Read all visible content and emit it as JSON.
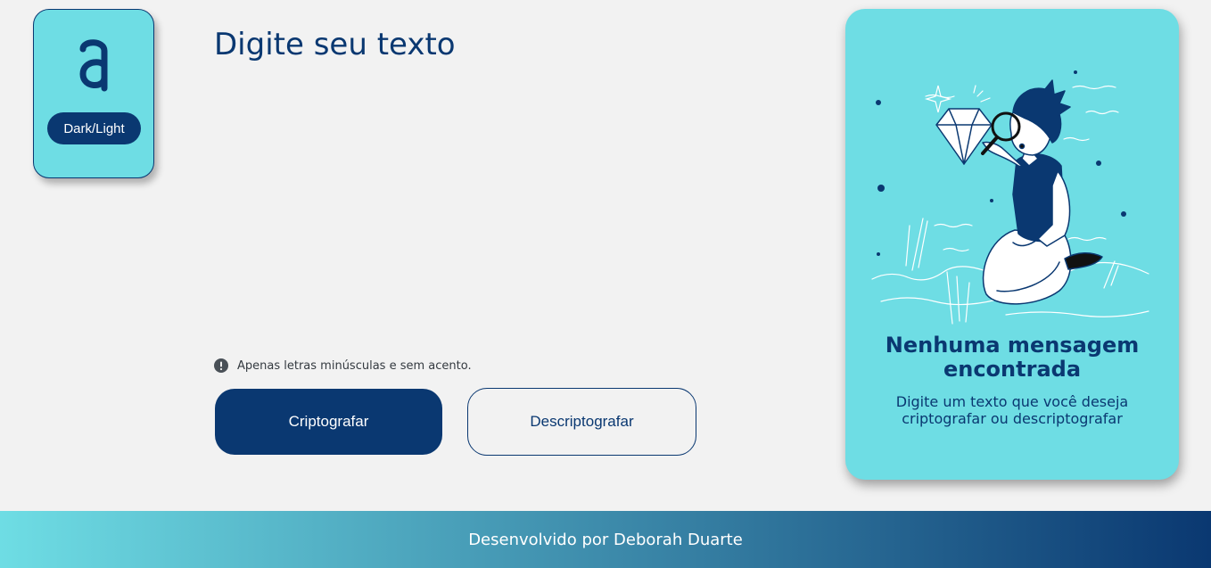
{
  "theme_toggle": {
    "label": "Dark/Light"
  },
  "editor": {
    "placeholder": "Digite seu texto"
  },
  "hint": {
    "text": "Apenas letras minúsculas e sem acento."
  },
  "actions": {
    "encrypt_label": "Criptografar",
    "decrypt_label": "Descriptografar"
  },
  "output": {
    "title_line1": "Nenhuma mensagem",
    "title_line2": "encontrada",
    "text_line1": "Digite um texto que você deseja",
    "text_line2": "criptografar ou descriptografar"
  },
  "footer": {
    "text": "Desenvolvido por Deborah Duarte"
  },
  "icons": {
    "logo": "alura-a-logo-icon",
    "hint": "exclamation-circle-icon"
  },
  "colors": {
    "accent": "#0a3871",
    "panel": "#6edde4",
    "background": "#f2f2f2"
  }
}
